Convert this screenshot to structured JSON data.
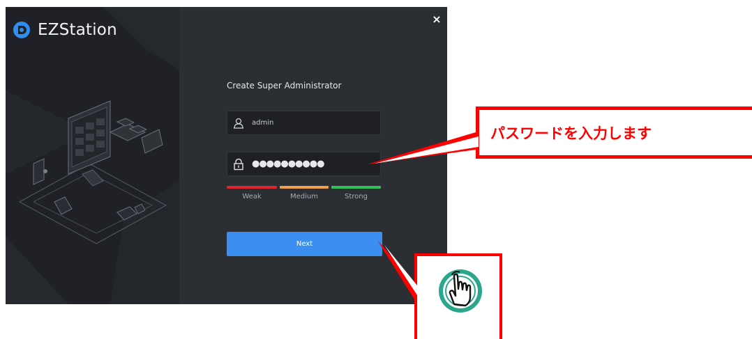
{
  "app": {
    "name": "EZStation",
    "logo_icon": "ezstation-logo-icon",
    "close_icon": "close-icon",
    "close_glyph": "×"
  },
  "form": {
    "title": "Create Super Administrator",
    "username": {
      "value": "admin",
      "icon": "user-icon"
    },
    "password": {
      "value": "●●●●●●●●●●",
      "icon": "lock-icon"
    },
    "strength": {
      "labels": [
        "Weak",
        "Medium",
        "Strong"
      ],
      "colors": [
        "#e0252d",
        "#f0a04d",
        "#2ec15d"
      ]
    },
    "next_label": "Next"
  },
  "annotation": {
    "callout_text": "パスワードを入力します",
    "color": "#ff0000",
    "pointer_icon": "tap-hand-icon"
  },
  "colors": {
    "dialog_bg": "#2b2e33",
    "sidebar_bg": "#1f2126",
    "accent": "#3a8ff0"
  }
}
